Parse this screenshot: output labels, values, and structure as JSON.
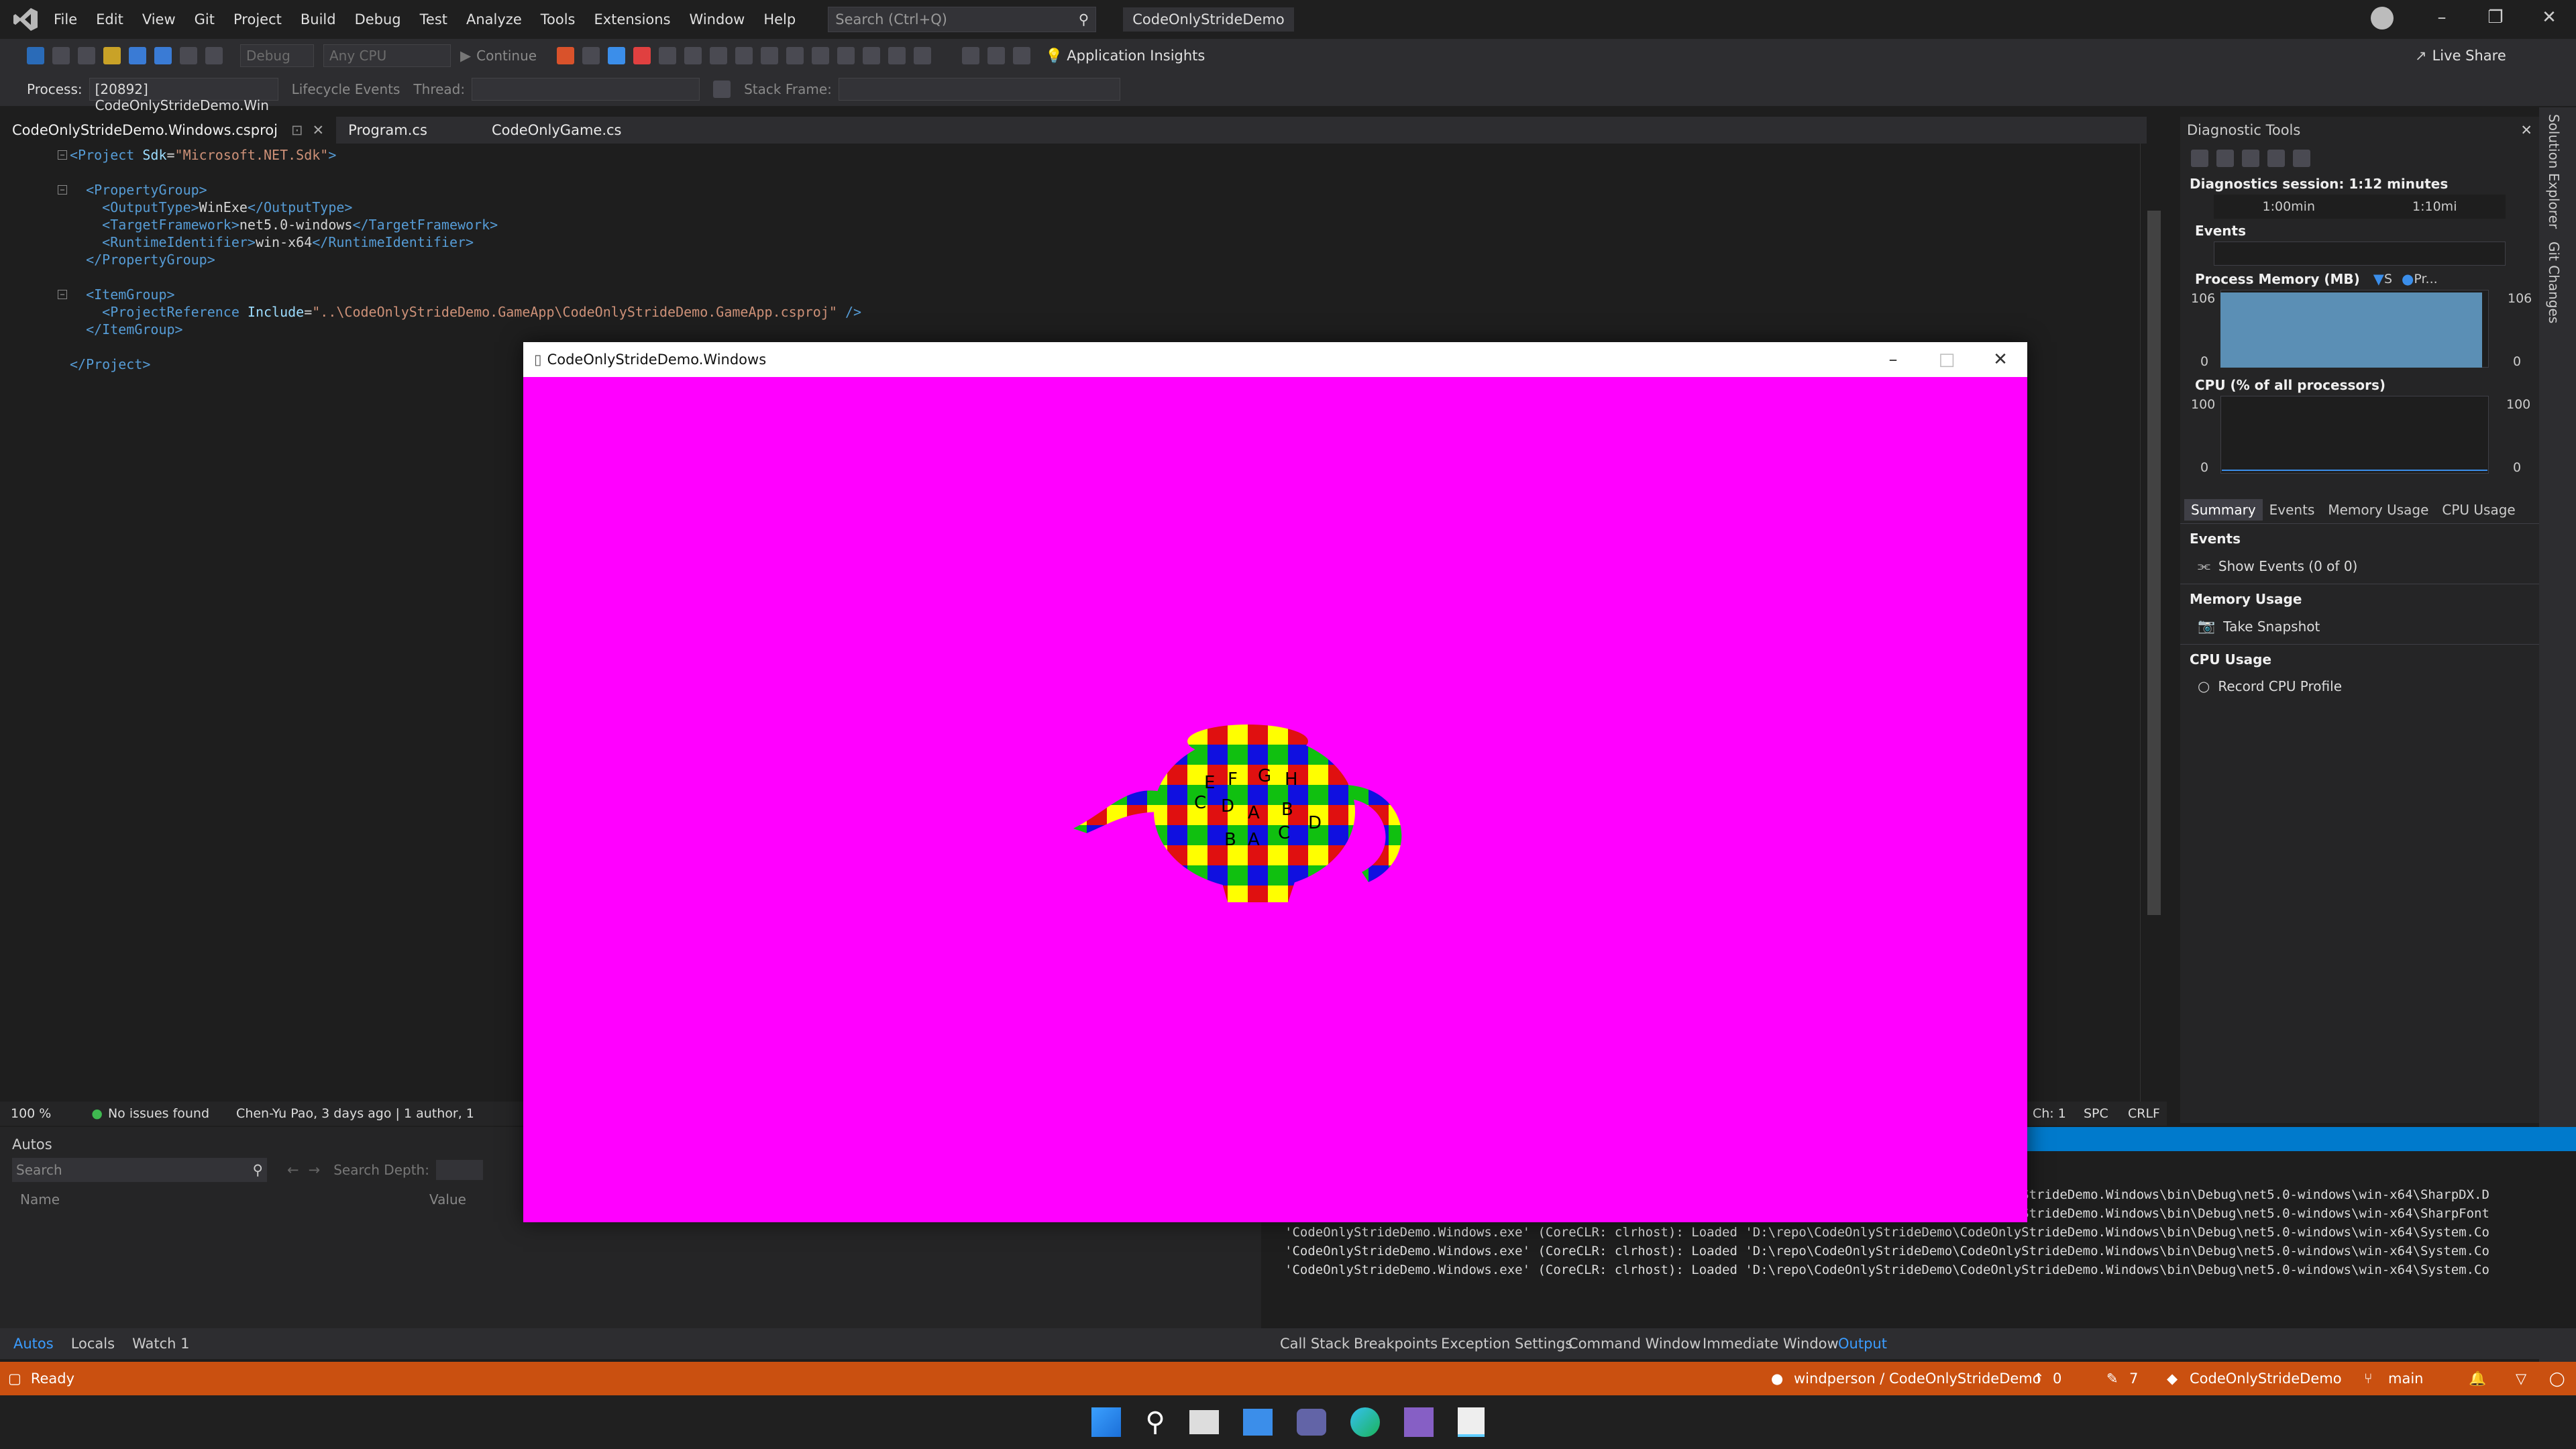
{
  "titlebar": {
    "menus": [
      "File",
      "Edit",
      "View",
      "Git",
      "Project",
      "Build",
      "Debug",
      "Test",
      "Analyze",
      "Tools",
      "Extensions",
      "Window",
      "Help"
    ],
    "search_placeholder": "Search (Ctrl+Q)",
    "solution_name": "CodeOnlyStrideDemo"
  },
  "toolbar": {
    "config": "Debug",
    "platform": "Any CPU",
    "continue_label": "Continue",
    "app_insights": "Application Insights",
    "live_share": "Live Share"
  },
  "toolbar2": {
    "process_label": "Process:",
    "process_value": "[20892] CodeOnlyStrideDemo.Win",
    "lifecycle": "Lifecycle Events",
    "thread_label": "Thread:",
    "stack_frame_label": "Stack Frame:"
  },
  "tabs": [
    {
      "label": "CodeOnlyStrideDemo.Windows.csproj"
    },
    {
      "label": "Program.cs"
    },
    {
      "label": "CodeOnlyGame.cs"
    }
  ],
  "editor": {
    "lines": [
      {
        "tag1": "<Project ",
        "attr": "Sdk",
        "eq": "=",
        "val": "\"Microsoft.NET.Sdk\"",
        "tag2": ">",
        "text": "",
        "close": ""
      },
      {
        "tag1": "",
        "attr": "",
        "eq": "",
        "val": "",
        "tag2": "",
        "text": "",
        "close": ""
      },
      {
        "tag1": "  <PropertyGroup>",
        "attr": "",
        "eq": "",
        "val": "",
        "tag2": "",
        "text": "",
        "close": ""
      },
      {
        "tag1": "    <OutputType>",
        "attr": "",
        "eq": "",
        "val": "",
        "tag2": "",
        "text": "WinExe",
        "close": "</OutputType>"
      },
      {
        "tag1": "    <TargetFramework>",
        "attr": "",
        "eq": "",
        "val": "",
        "tag2": "",
        "text": "net5.0-windows",
        "close": "</TargetFramework>"
      },
      {
        "tag1": "    <RuntimeIdentifier>",
        "attr": "",
        "eq": "",
        "val": "",
        "tag2": "",
        "text": "win-x64",
        "close": "</RuntimeIdentifier>"
      },
      {
        "tag1": "  </PropertyGroup>",
        "attr": "",
        "eq": "",
        "val": "",
        "tag2": "",
        "text": "",
        "close": ""
      },
      {
        "tag1": "",
        "attr": "",
        "eq": "",
        "val": "",
        "tag2": "",
        "text": "",
        "close": ""
      },
      {
        "tag1": "  <ItemGroup>",
        "attr": "",
        "eq": "",
        "val": "",
        "tag2": "",
        "text": "",
        "close": ""
      },
      {
        "tag1": "    <ProjectReference ",
        "attr": "Include",
        "eq": "=",
        "val": "\"..\\CodeOnlyStrideDemo.GameApp\\CodeOnlyStrideDemo.GameApp.csproj\"",
        "tag2": " />",
        "text": "",
        "close": ""
      },
      {
        "tag1": "  </ItemGroup>",
        "attr": "",
        "eq": "",
        "val": "",
        "tag2": "",
        "text": "",
        "close": ""
      },
      {
        "tag1": "",
        "attr": "",
        "eq": "",
        "val": "",
        "tag2": "",
        "text": "",
        "close": ""
      },
      {
        "tag1": "</Project>",
        "attr": "",
        "eq": "",
        "val": "",
        "tag2": "",
        "text": "",
        "close": ""
      }
    ]
  },
  "editor_status": {
    "zoom": "100 %",
    "issues": "No issues found",
    "blame": "Chen-Yu Pao, 3 days ago | 1 author, 1",
    "ch": "Ch: 1",
    "spc": "SPC",
    "crlf": "CRLF"
  },
  "game_window": {
    "title": "CodeOnlyStrideDemo.Windows",
    "bg": "#ff00ff",
    "letters": [
      "E",
      "F",
      "G",
      "H",
      "C",
      "D",
      "A",
      "B",
      "A",
      "C",
      "D",
      "B"
    ]
  },
  "diagnostics": {
    "title": "Diagnostic Tools",
    "session": "Diagnostics session: 1:12 minutes",
    "tick1": "1:00min",
    "tick2": "1:10mi",
    "events_label": "Events",
    "memory_label": "Process Memory (MB)",
    "memory_legend1": "S",
    "memory_legend2": "Pr...",
    "memory_max": "106",
    "memory_min": "0",
    "cpu_label": "CPU (% of all processors)",
    "cpu_max": "100",
    "cpu_min": "0",
    "tabs": [
      "Summary",
      "Events",
      "Memory Usage",
      "CPU Usage"
    ],
    "sec_events": "Events",
    "show_events": "Show Events (0 of 0)",
    "sec_memory": "Memory Usage",
    "take_snapshot": "Take Snapshot",
    "sec_cpu": "CPU Usage",
    "record_cpu": "Record CPU Profile"
  },
  "right_strip": {
    "solution_explorer": "Solution Explorer",
    "git_changes": "Git Changes"
  },
  "autos": {
    "title": "Autos",
    "search_placeholder": "Search",
    "search_depth": "Search Depth:",
    "col_name": "Name",
    "col_value": "Value"
  },
  "output": {
    "lines": [
      "'CodeOnlyStrideDemo.Windows.exe' (CoreCLR: clrhost): Loaded 'D:\\repo\\CodeOnlyStrideDemo\\CodeOnlyStrideDemo.Windows\\bin\\Debug\\net5.0-windows\\win-x64\\SharpDX.D",
      "'CodeOnlyStrideDemo.Windows.exe' (CoreCLR: clrhost): Loaded 'D:\\repo\\CodeOnlyStrideDemo\\CodeOnlyStrideDemo.Windows\\bin\\Debug\\net5.0-windows\\win-x64\\SharpFont",
      "'CodeOnlyStrideDemo.Windows.exe' (CoreCLR: clrhost): Loaded 'D:\\repo\\CodeOnlyStrideDemo\\CodeOnlyStrideDemo.Windows\\bin\\Debug\\net5.0-windows\\win-x64\\System.Co",
      "'CodeOnlyStrideDemo.Windows.exe' (CoreCLR: clrhost): Loaded 'D:\\repo\\CodeOnlyStrideDemo\\CodeOnlyStrideDemo.Windows\\bin\\Debug\\net5.0-windows\\win-x64\\System.Co",
      "'CodeOnlyStrideDemo.Windows.exe' (CoreCLR: clrhost): Loaded 'D:\\repo\\CodeOnlyStrideDemo\\CodeOnlyStrideDemo.Windows\\bin\\Debug\\net5.0-windows\\win-x64\\System.Co"
    ]
  },
  "bottom_tabs_left": [
    "Autos",
    "Locals",
    "Watch 1"
  ],
  "bottom_tabs_right": [
    "Call Stack",
    "Breakpoints",
    "Exception Settings",
    "Command Window",
    "Immediate Window",
    "Output"
  ],
  "status": {
    "ready": "Ready",
    "repo": "windperson / CodeOnlyStrideDemo",
    "push": "0",
    "pencil": "7",
    "project": "CodeOnlyStrideDemo",
    "branch": "main",
    "bg": "#ca5010"
  },
  "colors": {
    "accent": "#007acc",
    "vs_purple": "#865fc5"
  }
}
